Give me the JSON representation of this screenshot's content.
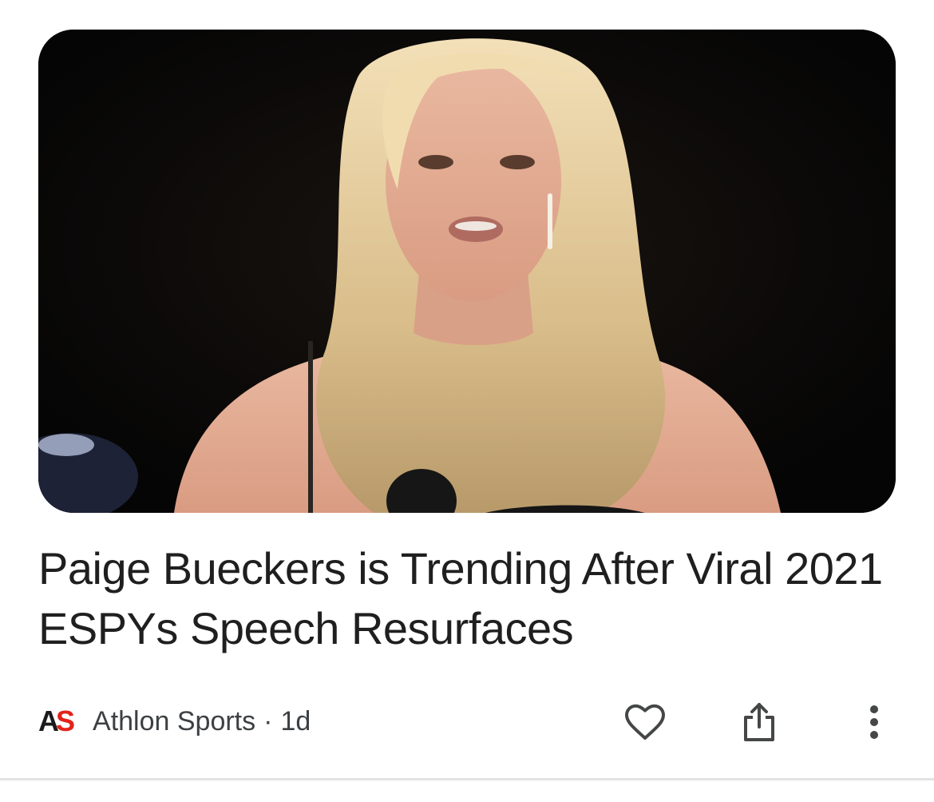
{
  "article": {
    "headline": "Paige Bueckers is Trending After Viral 2021 ESPYs Speech Resurfaces",
    "thumbnail_icon": "article-photo"
  },
  "meta": {
    "logo_part1": "A",
    "logo_part2": "S",
    "source": "Athlon Sports",
    "separator": "·",
    "age": "1d"
  },
  "actions": {
    "like_icon": "heart-icon",
    "share_icon": "share-icon",
    "more_icon": "more-vert-icon"
  },
  "colors": {
    "logo_accent": "#e2231a",
    "text_primary": "#1f1f1f",
    "text_secondary": "#3c4043",
    "icon": "#444746"
  }
}
